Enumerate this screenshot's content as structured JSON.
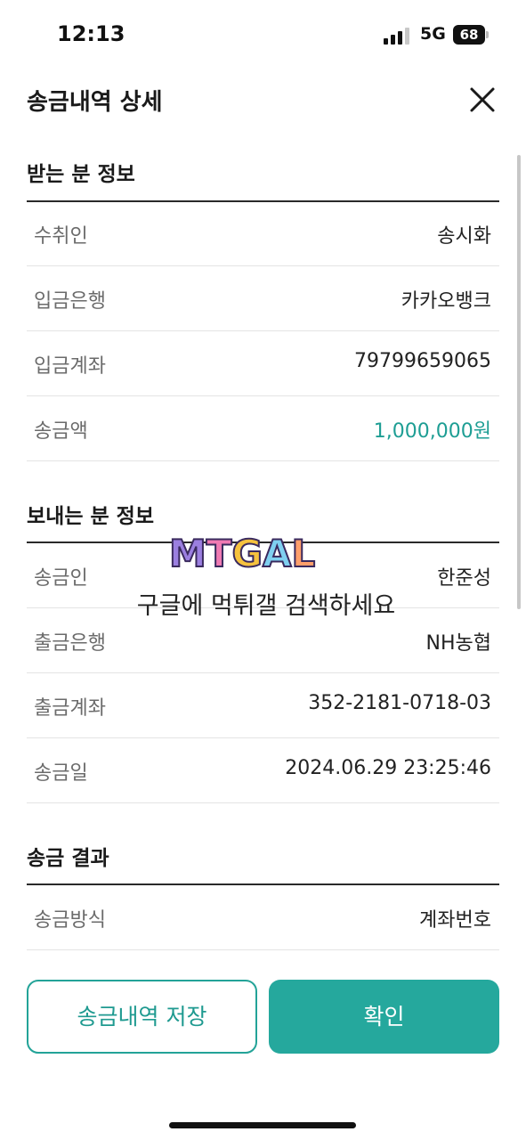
{
  "status_bar": {
    "time": "12:13",
    "network": "5G",
    "battery": "68"
  },
  "header": {
    "title": "송금내역 상세",
    "close_icon": "close-icon"
  },
  "recipient_section": {
    "title": "받는 분 정보",
    "rows": [
      {
        "label": "수취인",
        "value": "송시화"
      },
      {
        "label": "입금은행",
        "value": "카카오뱅크"
      },
      {
        "label": "입금계좌",
        "value": "79799659065"
      },
      {
        "label": "송금액",
        "value": "1,000,000원"
      }
    ]
  },
  "sender_section": {
    "title": "보내는 분 정보",
    "rows": [
      {
        "label": "송금인",
        "value": "한준성"
      },
      {
        "label": "출금은행",
        "value": "NH농협"
      },
      {
        "label": "출금계좌",
        "value": "352-2181-0718-03"
      },
      {
        "label": "송금일",
        "value": "2024.06.29 23:25:46"
      }
    ]
  },
  "result_section": {
    "title": "송금 결과",
    "rows": [
      {
        "label": "송금방식",
        "value": "계좌번호"
      }
    ]
  },
  "watermark": {
    "logo": "MTGAL",
    "text": "구글에 먹튀갤 검색하세요"
  },
  "buttons": {
    "save_label": "송금내역 저장",
    "confirm_label": "확인"
  },
  "colors": {
    "accent": "#25a89d",
    "amount": "#1e9e94"
  }
}
